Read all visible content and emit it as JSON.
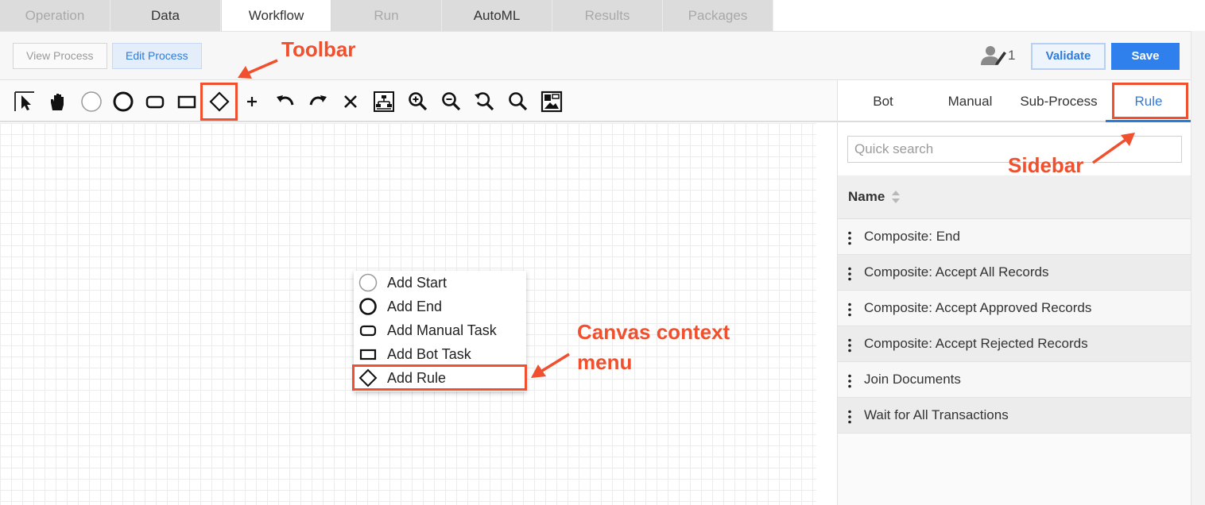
{
  "tabs": [
    {
      "label": "Operation",
      "state": "disabled"
    },
    {
      "label": "Data",
      "state": "enabled"
    },
    {
      "label": "Workflow",
      "state": "active"
    },
    {
      "label": "Run",
      "state": "disabled"
    },
    {
      "label": "AutoML",
      "state": "enabled"
    },
    {
      "label": "Results",
      "state": "disabled"
    },
    {
      "label": "Packages",
      "state": "disabled"
    }
  ],
  "header": {
    "view_process": "View Process",
    "edit_process": "Edit Process",
    "user_count": "1",
    "validate": "Validate",
    "save": "Save"
  },
  "toolbar": {
    "tools": [
      "pointer-tool-icon",
      "hand-pan-icon",
      "start-event-icon",
      "end-event-icon",
      "manual-task-icon",
      "bot-task-icon",
      "rule-diamond-icon",
      "add-icon",
      "undo-icon",
      "redo-icon",
      "delete-icon",
      "auto-layout-icon",
      "zoom-in-icon",
      "zoom-out-icon",
      "zoom-reset-icon",
      "zoom-search-icon",
      "fit-image-icon"
    ]
  },
  "context_menu": {
    "items": [
      {
        "label": "Add Start",
        "icon": "start-circle-icon"
      },
      {
        "label": "Add End",
        "icon": "end-circle-icon"
      },
      {
        "label": "Add Manual Task",
        "icon": "manual-task-icon"
      },
      {
        "label": "Add Bot Task",
        "icon": "bot-task-icon"
      },
      {
        "label": "Add Rule",
        "icon": "rule-diamond-icon"
      }
    ]
  },
  "sidebar": {
    "tabs": [
      {
        "label": "Bot"
      },
      {
        "label": "Manual"
      },
      {
        "label": "Sub-Process"
      },
      {
        "label": "Rule",
        "active": true
      }
    ],
    "search_placeholder": "Quick search",
    "column_header": "Name",
    "rows": [
      "Composite: End",
      "Composite: Accept All Records",
      "Composite: Accept Approved Records",
      "Composite: Accept Rejected Records",
      "Join Documents",
      "Wait for All Transactions"
    ]
  },
  "annotations": {
    "toolbar": "Toolbar",
    "sidebar": "Sidebar",
    "canvas_menu_line1": "Canvas context",
    "canvas_menu_line2": "menu"
  },
  "colors": {
    "accent": "#2e7bd9",
    "save_button": "#2f80ed",
    "annotation": "#f0502e"
  }
}
